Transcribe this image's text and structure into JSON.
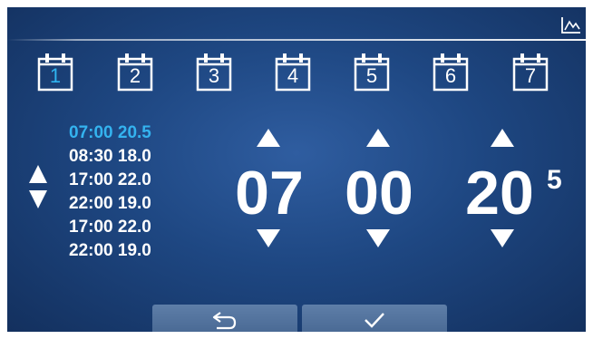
{
  "days": [
    {
      "label": "1",
      "active": true
    },
    {
      "label": "2",
      "active": false
    },
    {
      "label": "3",
      "active": false
    },
    {
      "label": "4",
      "active": false
    },
    {
      "label": "5",
      "active": false
    },
    {
      "label": "6",
      "active": false
    },
    {
      "label": "7",
      "active": false
    }
  ],
  "schedule": [
    {
      "text": "07:00 20.5",
      "active": true
    },
    {
      "text": "08:30 18.0",
      "active": false
    },
    {
      "text": "17:00 22.0",
      "active": false
    },
    {
      "text": "22:00 19.0",
      "active": false
    },
    {
      "text": "17:00 22.0",
      "active": false
    },
    {
      "text": "22:00 19.0",
      "active": false
    }
  ],
  "editor": {
    "hour": "07",
    "minute": "00",
    "temp_int": "20",
    "temp_dec": "5"
  },
  "icons": {
    "chart": "chart-icon",
    "calendar": "calendar-icon",
    "back": "back-arrow-icon",
    "confirm": "checkmark-icon",
    "up": "arrow-up-icon",
    "down": "arrow-down-icon"
  },
  "colors": {
    "background": "#1e4782",
    "active_text": "#34b3ef",
    "button": "#5672a0"
  }
}
